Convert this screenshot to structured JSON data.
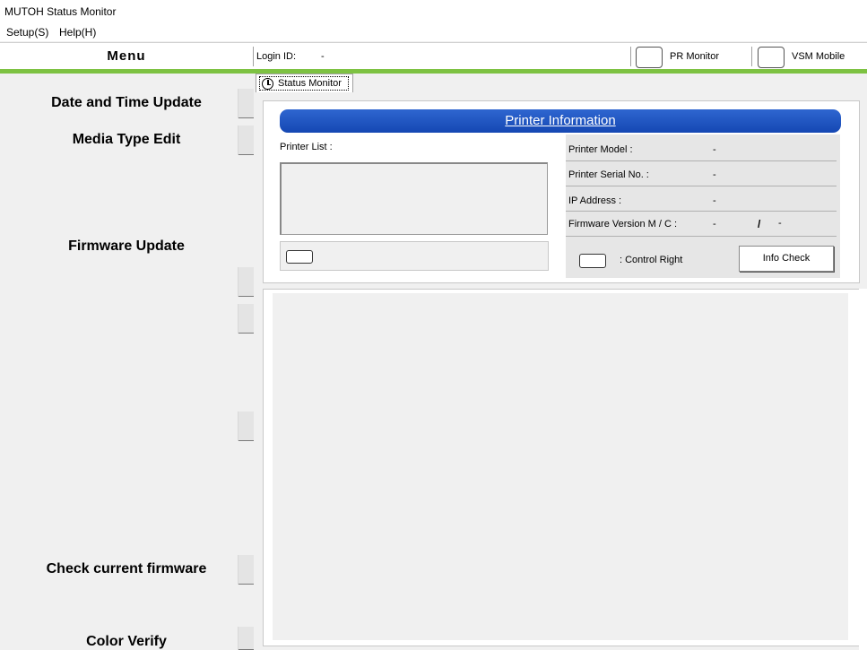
{
  "window": {
    "title": "MUTOH Status Monitor"
  },
  "menubar": {
    "setup": "Setup(S)",
    "help": "Help(H)"
  },
  "header": {
    "menu_title": "Menu",
    "login_label": "Login ID:",
    "login_value": "-",
    "pr_monitor_label": "PR Monitor",
    "vsm_mobile_label": "VSM Mobile"
  },
  "sidebar": {
    "items": [
      {
        "label": "Date and Time Update"
      },
      {
        "label": "Media Type Edit"
      },
      {
        "label": "Firmware Update"
      },
      {
        "label": "Check current firmware"
      },
      {
        "label": "Color Verify"
      }
    ]
  },
  "tabs": {
    "status_monitor": "Status Monitor"
  },
  "printer_info": {
    "title": "Printer Information",
    "printer_list_label": "Printer List :",
    "model_label": "Printer Model :",
    "model_value": "-",
    "serial_label": "Printer Serial No. :",
    "serial_value": "-",
    "ip_label": "IP Address :",
    "ip_value": "-",
    "firmware_label": "Firmware Version M / C :",
    "firmware_m": "-",
    "firmware_slash": "/",
    "firmware_c": "-",
    "control_right_label": ": Control Right",
    "info_check_label": "Info Check"
  }
}
